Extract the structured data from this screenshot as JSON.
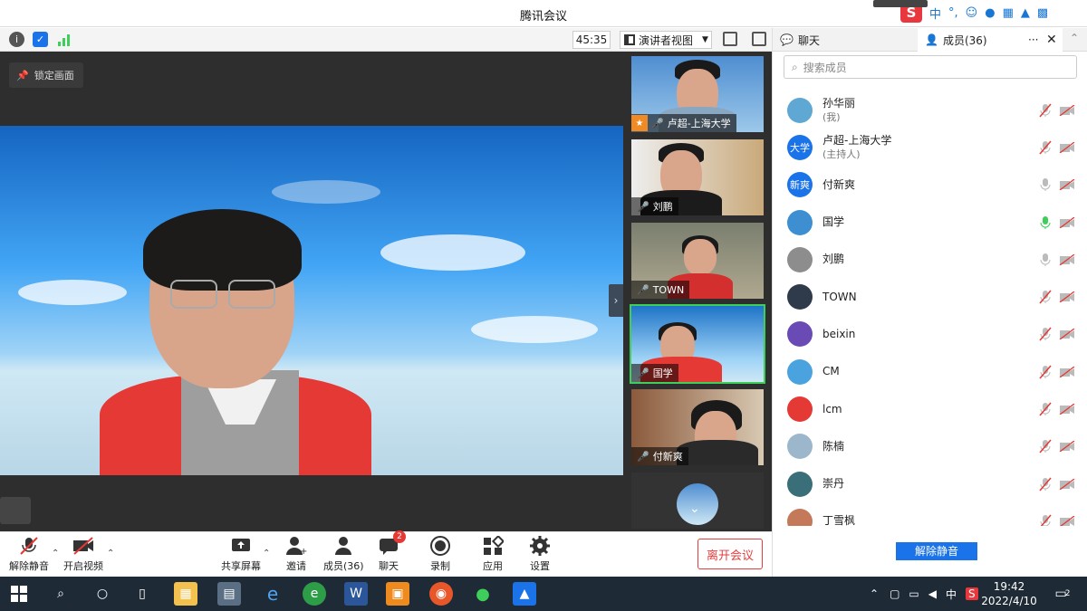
{
  "window": {
    "title": "腾讯会议"
  },
  "ime": {
    "mode": "中",
    "punct": "°,"
  },
  "toolbar": {
    "timer": "45:35",
    "view_mode": "演讲者视图"
  },
  "main_video": {
    "lock_label": "锁定画面"
  },
  "thumbnails": [
    {
      "name": "卢超-上海大学",
      "host": true,
      "mic": "muted"
    },
    {
      "name": "刘鹏",
      "host": false,
      "mic": "on"
    },
    {
      "name": "TOWN",
      "host": false,
      "mic": "muted"
    },
    {
      "name": "国学",
      "host": false,
      "mic": "on"
    },
    {
      "name": "付新爽",
      "host": false,
      "mic": "on"
    }
  ],
  "panel": {
    "tab_chat": "聊天",
    "tab_members": "成员(36)",
    "search_placeholder": "搜索成员",
    "unmute_all": "解除静音",
    "members": [
      {
        "name": "孙华丽",
        "sub": "(我)",
        "avatar_text": "",
        "avatar_color": "#5fa8d3",
        "mic": "muted"
      },
      {
        "name": "卢超-上海大学",
        "sub": "(主持人)",
        "avatar_text": "大学",
        "avatar_color": "#1a73e8",
        "mic": "muted"
      },
      {
        "name": "付新爽",
        "sub": "",
        "avatar_text": "新爽",
        "avatar_color": "#1a73e8",
        "mic": "on"
      },
      {
        "name": "国学",
        "sub": "",
        "avatar_text": "",
        "avatar_color": "#3d8fd1",
        "mic": "speaking"
      },
      {
        "name": "刘鹏",
        "sub": "",
        "avatar_text": "",
        "avatar_color": "#8d8d8d",
        "mic": "on"
      },
      {
        "name": "TOWN",
        "sub": "",
        "avatar_text": "",
        "avatar_color": "#2f3b4a",
        "mic": "muted"
      },
      {
        "name": "beixin",
        "sub": "",
        "avatar_text": "",
        "avatar_color": "#6a4bb5",
        "mic": "muted"
      },
      {
        "name": "CM",
        "sub": "",
        "avatar_text": "",
        "avatar_color": "#4aa3df",
        "mic": "muted"
      },
      {
        "name": "lcm",
        "sub": "",
        "avatar_text": "",
        "avatar_color": "#e53935",
        "mic": "muted"
      },
      {
        "name": "陈楠",
        "sub": "",
        "avatar_text": "",
        "avatar_color": "#9cb7cc",
        "mic": "muted"
      },
      {
        "name": "崇丹",
        "sub": "",
        "avatar_text": "",
        "avatar_color": "#3a6f7a",
        "mic": "muted"
      },
      {
        "name": "丁雪枫",
        "sub": "",
        "avatar_text": "",
        "avatar_color": "#c47a5a",
        "mic": "muted"
      }
    ]
  },
  "controls": {
    "unmute": "解除静音",
    "start_video": "开启视频",
    "share": "共享屏幕",
    "invite": "邀请",
    "members": "成员(36)",
    "chat": "聊天",
    "chat_badge": "2",
    "record": "录制",
    "apps": "应用",
    "settings": "设置",
    "leave": "离开会议"
  },
  "taskbar": {
    "time": "19:42",
    "date": "2022/4/10",
    "ime": "中",
    "notifications": "2"
  },
  "colors": {
    "accent": "#1a73e8",
    "danger": "#e53935",
    "speaking": "#3ecf5a",
    "host": "#f08a24"
  }
}
